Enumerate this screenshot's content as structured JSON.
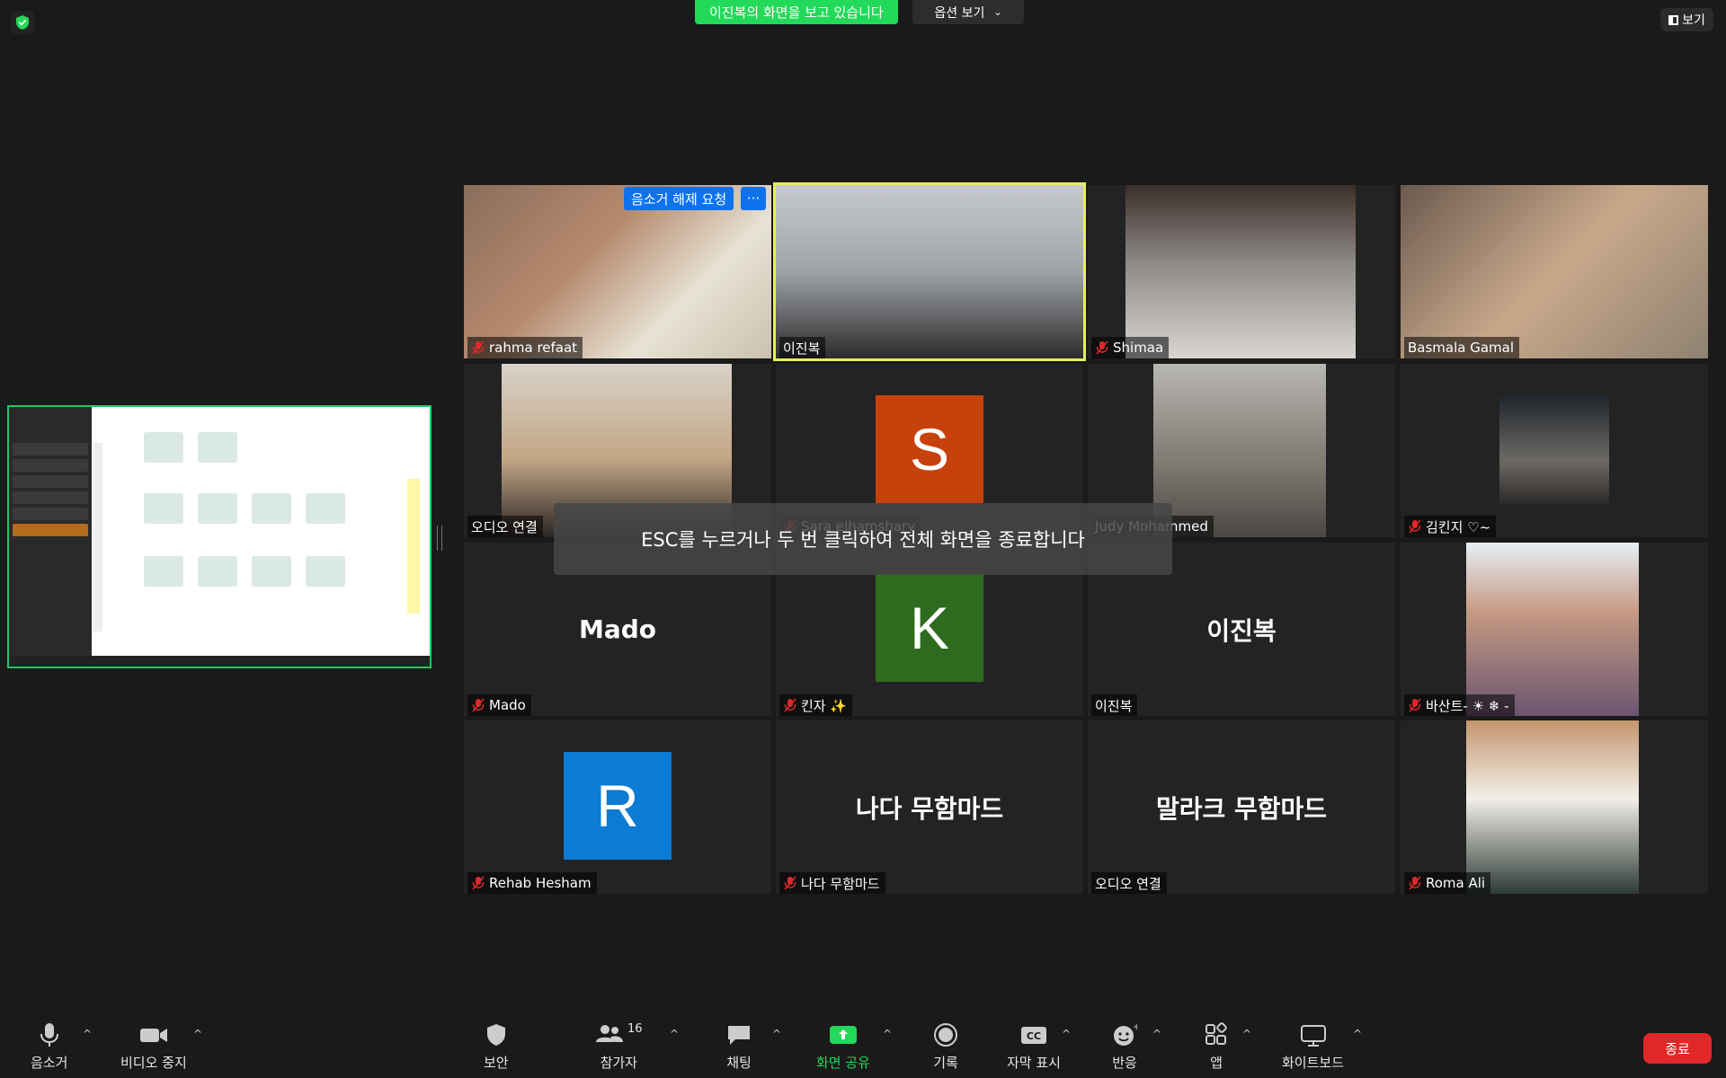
{
  "top": {
    "share_banner": "이진복의 화면을 보고 있습니다",
    "view_options": "옵션 보기",
    "view_button": "보기"
  },
  "tiles": [
    {
      "name": "rahma refaat",
      "muted": true
    },
    {
      "name": "이진복",
      "muted": false
    },
    {
      "name": "Shimaa",
      "muted": true
    },
    {
      "name": "Basmala Gamal",
      "muted": false
    },
    {
      "name": "오디오 연결",
      "muted": false
    },
    {
      "name": "Sara elhamshary",
      "muted": true,
      "avatar": "S",
      "avatar_color": "#c7410c"
    },
    {
      "name": "Judy Mohammed",
      "muted": false
    },
    {
      "name": "김킨지 ♡~",
      "muted": true
    },
    {
      "name": "Mado",
      "muted": true,
      "big_label": "Mado"
    },
    {
      "name": "킨자 ✨",
      "muted": true,
      "avatar": "K",
      "avatar_color": "#2e6b1e"
    },
    {
      "name": "이진복",
      "muted": false,
      "big_label": "이진복"
    },
    {
      "name": "바산트- ☀ ❄ -",
      "muted": true
    },
    {
      "name": "Rehab Hesham",
      "muted": true,
      "avatar": "R",
      "avatar_color": "#0b7bd4"
    },
    {
      "name": "나다 무함마드",
      "muted": true,
      "big_label": "나다 무함마드"
    },
    {
      "name": "오디오 연결",
      "muted": false,
      "big_label": "말라크 무함마드"
    },
    {
      "name": "Roma Ali",
      "muted": true
    }
  ],
  "overlay": {
    "unmute_request": "음소거 해제 요청",
    "more": "···",
    "esc_message": "ESC를 누르거나 두 번 클릭하여 전체 화면을 종료합니다"
  },
  "toolbar": {
    "mute": "음소거",
    "video": "비디오 중지",
    "security": "보안",
    "participants": "참가자",
    "participants_count": "16",
    "chat": "채팅",
    "share": "화면 공유",
    "record": "기록",
    "captions": "자막 표시",
    "reactions": "반응",
    "apps": "앱",
    "whiteboard": "화이트보드",
    "end": "종료"
  },
  "colors": {
    "accent_green": "#23d959",
    "blue": "#0e72ed",
    "end_red": "#e02828",
    "active_speaker": "#e6ef5c"
  }
}
